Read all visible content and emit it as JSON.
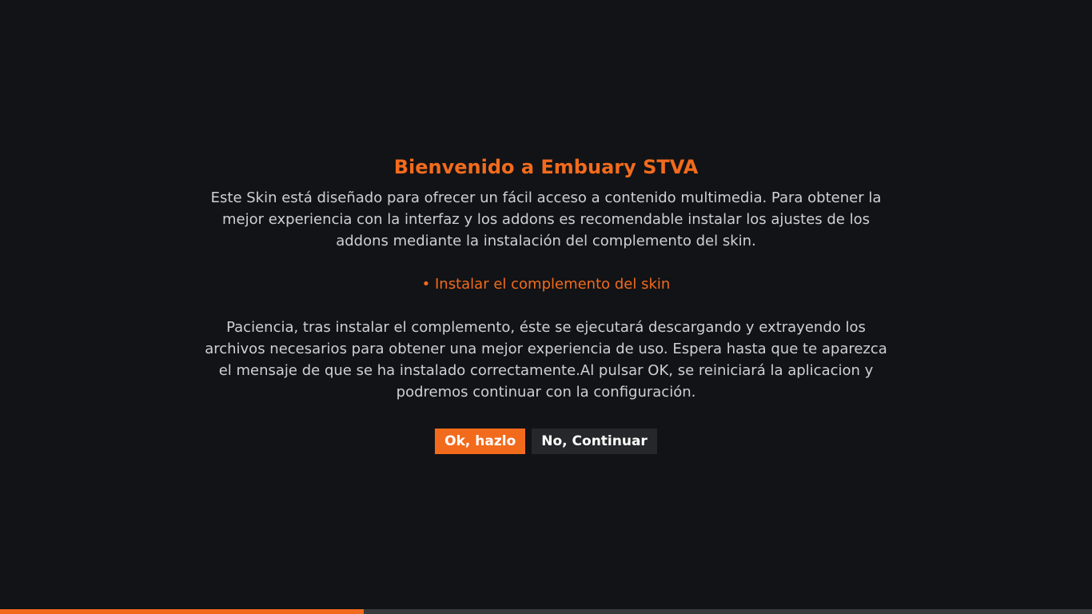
{
  "dialog": {
    "title": "Bienvenido a Embuary STVA",
    "paragraph_1": "Este Skin está diseñado para ofrecer un fácil acceso a contenido multimedia. Para obtener la mejor experiencia con la interfaz y los addons es recomendable instalar los ajustes de los addons mediante la instalación del complemento del skin.",
    "bullet": "• Instalar el complemento del skin",
    "paragraph_2": "Paciencia, tras instalar el complemento, éste se ejecutará descargando y extrayendo los archivos necesarios para obtener una mejor experiencia de uso. Espera hasta que te aparezca el mensaje de que se ha instalado correctamente.Al pulsar OK, se reiniciará la aplicacion y podremos continuar con la configuración.",
    "buttons": {
      "ok_label": "Ok, hazlo",
      "no_label": "No, Continuar"
    }
  },
  "progress": {
    "fraction": 0.333
  },
  "colors": {
    "accent": "#f26b1d",
    "background": "#121316",
    "text": "#d0d0d2",
    "secondary_button": "#26272a",
    "progress_track": "#3a3b3e"
  }
}
